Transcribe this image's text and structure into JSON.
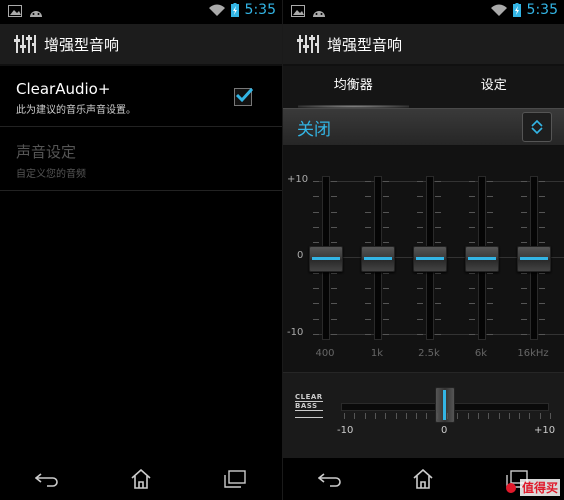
{
  "status": {
    "time": "5:35"
  },
  "app": {
    "title": "增强型音响"
  },
  "settings": {
    "items": [
      {
        "title": "ClearAudio+",
        "summary": "此为建议的音乐声音设置。",
        "checked": true
      },
      {
        "title": "声音设定",
        "summary": "自定义您的音频",
        "disabled": true
      }
    ]
  },
  "equalizer": {
    "tabs": [
      {
        "label": "均衡器",
        "active": true
      },
      {
        "label": "设定",
        "active": false
      }
    ],
    "preset": "关闭",
    "scale": {
      "max": "+10",
      "mid": "0",
      "min": "-10"
    },
    "bands": [
      {
        "freq": "400",
        "value": 0
      },
      {
        "freq": "1k",
        "value": 0
      },
      {
        "freq": "2.5k",
        "value": 0
      },
      {
        "freq": "6k",
        "value": 0
      },
      {
        "freq": "16kHz",
        "value": 0
      }
    ],
    "clear_bass": {
      "logo_top": "CLEAR",
      "logo_bottom": "BASS",
      "min": "-10",
      "mid": "0",
      "max": "+10",
      "value": 0
    }
  },
  "watermark": {
    "text": "值得买"
  },
  "colors": {
    "accent": "#33b5e5",
    "background": "#000000"
  },
  "icons": {
    "status_left": [
      "gallery-icon",
      "android-icon"
    ],
    "status_right": [
      "wifi-icon",
      "battery-charging-icon"
    ],
    "nav": [
      "back-icon",
      "home-icon",
      "recent-apps-icon"
    ]
  }
}
